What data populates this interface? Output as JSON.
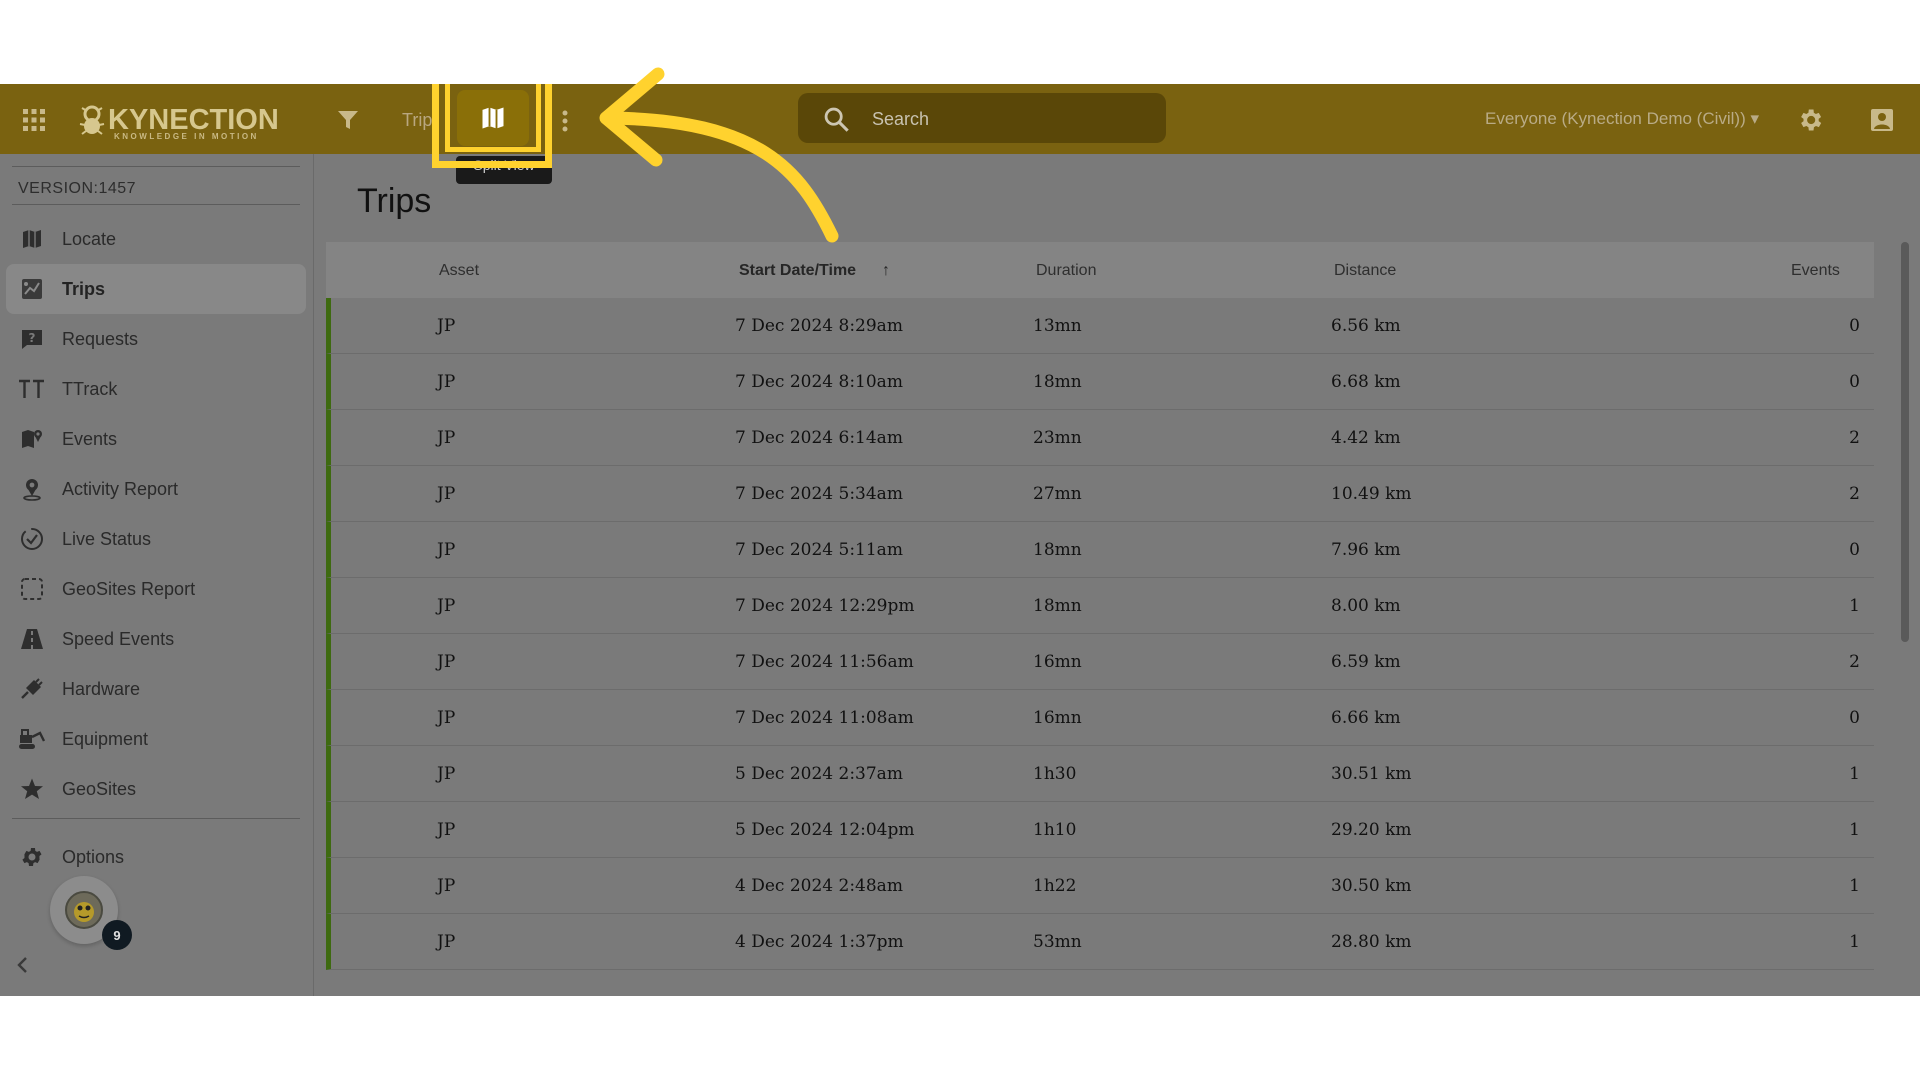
{
  "header": {
    "logo_text": "KYNECTION",
    "logo_tagline": "KNOWLEDGE IN MOTION",
    "breadcrumb": "Trip",
    "split_view_tooltip": "Split View",
    "search_placeholder": "Search",
    "scope_selector": "Everyone (Kynection Demo (Civil)) ▾"
  },
  "sidebar": {
    "version": "VERSION:1457",
    "items": [
      {
        "label": "Locate",
        "icon": "map-icon",
        "active": false
      },
      {
        "label": "Trips",
        "icon": "trips-icon",
        "active": true
      },
      {
        "label": "Requests",
        "icon": "question-chat-icon",
        "active": false
      },
      {
        "label": "TTrack",
        "icon": "ttrack-icon",
        "active": false
      },
      {
        "label": "Events",
        "icon": "map-pin-icon",
        "active": false
      },
      {
        "label": "Activity Report",
        "icon": "person-pin-icon",
        "active": false
      },
      {
        "label": "Live Status",
        "icon": "check-circle-icon",
        "active": false
      },
      {
        "label": "GeoSites Report",
        "icon": "dashed-square-icon",
        "active": false
      },
      {
        "label": "Speed Events",
        "icon": "road-icon",
        "active": false
      },
      {
        "label": "Hardware",
        "icon": "plug-icon",
        "active": false
      },
      {
        "label": "Equipment",
        "icon": "excavator-icon",
        "active": false
      },
      {
        "label": "GeoSites",
        "icon": "star-icon",
        "active": false
      }
    ],
    "options_label": "Options",
    "notification_count": "9"
  },
  "main": {
    "title": "Trips",
    "columns": {
      "asset": "Asset",
      "start": "Start Date/Time",
      "sort_indicator": "↑",
      "duration": "Duration",
      "distance": "Distance",
      "events": "Events"
    },
    "rows": [
      {
        "asset": "JP",
        "start": "7 Dec 2024 8:29am",
        "duration": "13mn",
        "distance": "6.56 km",
        "events": "0"
      },
      {
        "asset": "JP",
        "start": "7 Dec 2024 8:10am",
        "duration": "18mn",
        "distance": "6.68 km",
        "events": "0"
      },
      {
        "asset": "JP",
        "start": "7 Dec 2024 6:14am",
        "duration": "23mn",
        "distance": "4.42 km",
        "events": "2"
      },
      {
        "asset": "JP",
        "start": "7 Dec 2024 5:34am",
        "duration": "27mn",
        "distance": "10.49 km",
        "events": "2"
      },
      {
        "asset": "JP",
        "start": "7 Dec 2024 5:11am",
        "duration": "18mn",
        "distance": "7.96 km",
        "events": "0"
      },
      {
        "asset": "JP",
        "start": "7 Dec 2024 12:29pm",
        "duration": "18mn",
        "distance": "8.00 km",
        "events": "1"
      },
      {
        "asset": "JP",
        "start": "7 Dec 2024 11:56am",
        "duration": "16mn",
        "distance": "6.59 km",
        "events": "2"
      },
      {
        "asset": "JP",
        "start": "7 Dec 2024 11:08am",
        "duration": "16mn",
        "distance": "6.66 km",
        "events": "0"
      },
      {
        "asset": "JP",
        "start": "5 Dec 2024 2:37am",
        "duration": "1h30",
        "distance": "30.51 km",
        "events": "1"
      },
      {
        "asset": "JP",
        "start": "5 Dec 2024 12:04pm",
        "duration": "1h10",
        "distance": "29.20 km",
        "events": "1"
      },
      {
        "asset": "JP",
        "start": "4 Dec 2024 2:48am",
        "duration": "1h22",
        "distance": "30.50 km",
        "events": "1"
      },
      {
        "asset": "JP",
        "start": "4 Dec 2024 1:37pm",
        "duration": "53mn",
        "distance": "28.80 km",
        "events": "1"
      }
    ]
  },
  "colors": {
    "topbar": "#7a6210",
    "highlight": "#ffd22e",
    "row_accent": "#3e6a10"
  }
}
